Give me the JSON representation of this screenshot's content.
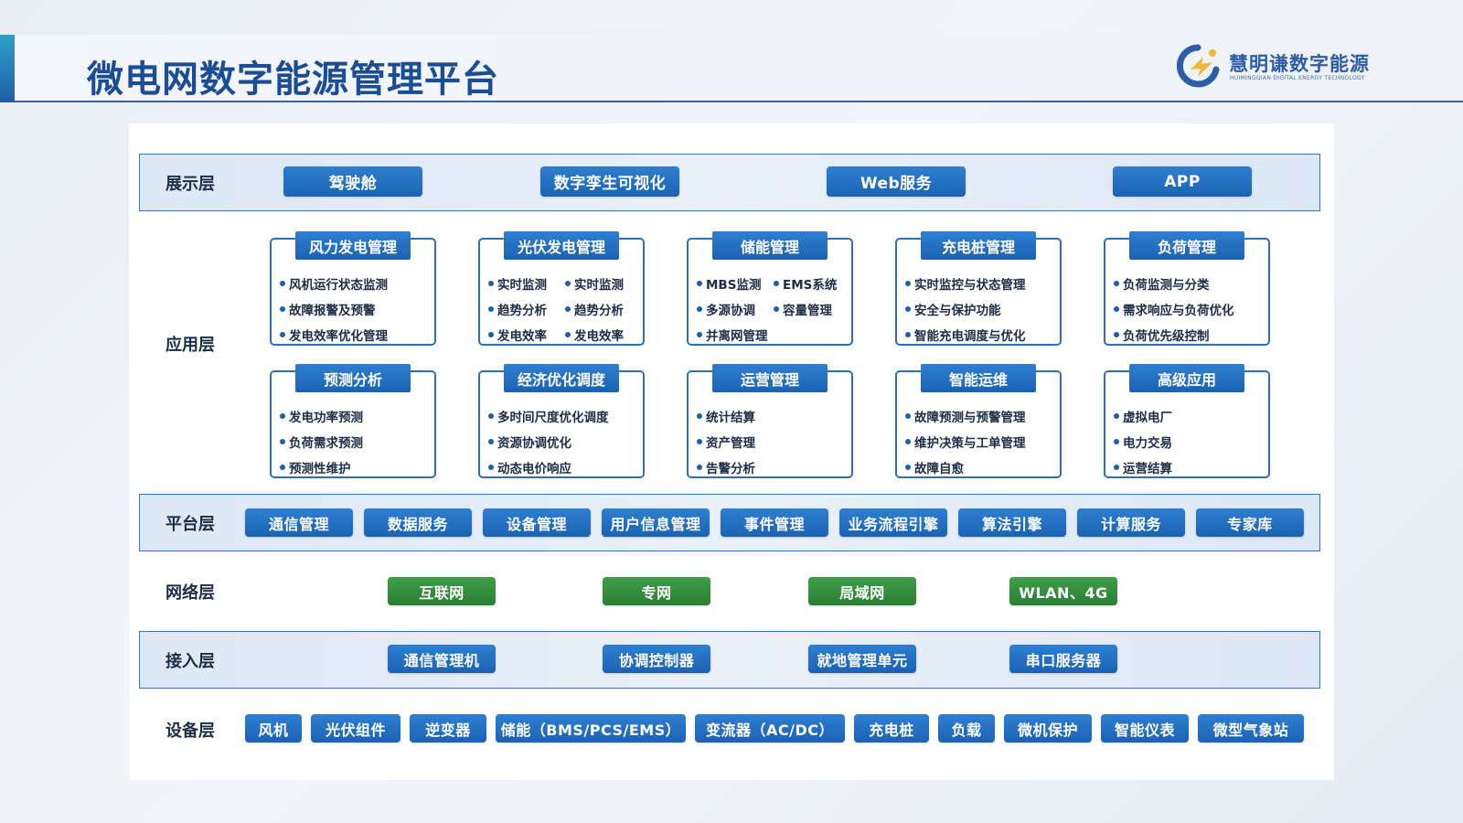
{
  "page_title": "微电网数字能源管理平台",
  "brand": {
    "name": "慧明谦数字能源",
    "name_en": "HUIMINGQIAN DIGITAL ENERGY TECHNOLOGY"
  },
  "colors": {
    "primary_blue": "#1c62b4",
    "network_green": "#2b7f35",
    "title_blue": "#1b4c96"
  },
  "layers": {
    "display": {
      "label": "展示层",
      "items": [
        "驾驶舱",
        "数字孪生可视化",
        "Web服务",
        "APP"
      ]
    },
    "application": {
      "label": "应用层",
      "modules": [
        {
          "title": "风力发电管理",
          "items": [
            "风机运行状态监测",
            "故障报警及预警",
            "发电效率优化管理"
          ]
        },
        {
          "title": "光伏发电管理",
          "rows": [
            [
              "实时监测",
              "实时监测"
            ],
            [
              "趋势分析",
              "趋势分析"
            ],
            [
              "发电效率",
              "发电效率"
            ]
          ]
        },
        {
          "title": "储能管理",
          "rows": [
            [
              "MBS监测",
              "EMS系统"
            ],
            [
              "多源协调",
              "容量管理"
            ],
            [
              "并离网管理"
            ]
          ]
        },
        {
          "title": "充电桩管理",
          "items": [
            "实时监控与状态管理",
            "安全与保护功能",
            "智能充电调度与优化"
          ]
        },
        {
          "title": "负荷管理",
          "items": [
            "负荷监测与分类",
            "需求响应与负荷优化",
            "负荷优先级控制"
          ]
        },
        {
          "title": "预测分析",
          "items": [
            "发电功率预测",
            "负荷需求预测",
            "预测性维护"
          ]
        },
        {
          "title": "经济优化调度",
          "items": [
            "多时间尺度优化调度",
            "资源协调优化",
            "动态电价响应"
          ]
        },
        {
          "title": "运营管理",
          "items": [
            "统计结算",
            "资产管理",
            "告警分析"
          ]
        },
        {
          "title": "智能运维",
          "items": [
            "故障预测与预警管理",
            "维护决策与工单管理",
            "故障自愈"
          ]
        },
        {
          "title": "高级应用",
          "items": [
            "虚拟电厂",
            "电力交易",
            "运营结算"
          ]
        }
      ]
    },
    "platform": {
      "label": "平台层",
      "items": [
        "通信管理",
        "数据服务",
        "设备管理",
        "用户信息管理",
        "事件管理",
        "业务流程引擎",
        "算法引擎",
        "计算服务",
        "专家库"
      ]
    },
    "network": {
      "label": "网络层",
      "items": [
        "互联网",
        "专网",
        "局域网",
        "WLAN、4G"
      ]
    },
    "access": {
      "label": "接入层",
      "items": [
        "通信管理机",
        "协调控制器",
        "就地管理单元",
        "串口服务器"
      ]
    },
    "device": {
      "label": "设备层",
      "items": [
        "风机",
        "光伏组件",
        "逆变器",
        "储能（BMS/PCS/EMS）",
        "变流器（AC/DC）",
        "充电桩",
        "负载",
        "微机保护",
        "智能仪表",
        "微型气象站"
      ]
    }
  }
}
